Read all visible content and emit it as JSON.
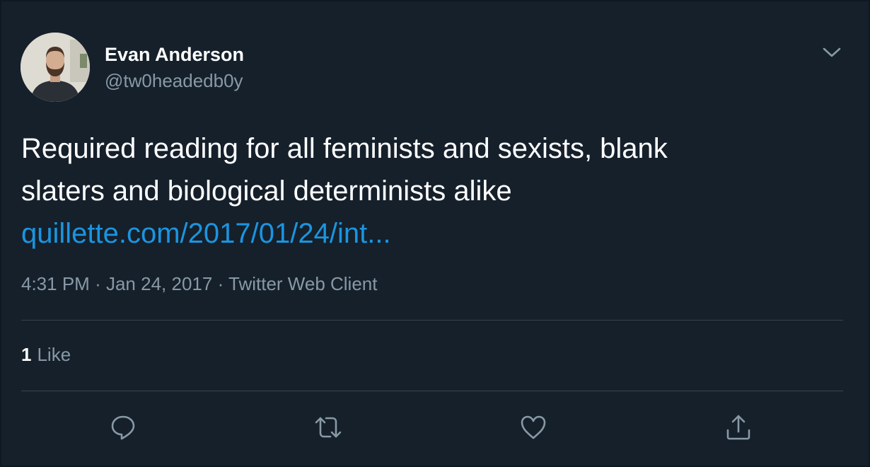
{
  "tweet": {
    "author": {
      "name": "Evan Anderson",
      "handle": "@tw0headedb0y"
    },
    "text_line_1": "Required reading for all feminists and sexists, blank",
    "text_line_2": "slaters and biological determinists alike",
    "link_text": "quillette.com/2017/01/24/int...",
    "time": "4:31 PM",
    "separator": "·",
    "date": "Jan 24, 2017",
    "client": "Twitter Web Client",
    "like_count": "1",
    "like_label": "Like"
  },
  "icons": {
    "menu": "chevron-down-icon",
    "reply": "reply-icon",
    "retweet": "retweet-icon",
    "like": "heart-icon",
    "share": "share-icon"
  },
  "colors": {
    "background": "#15202b",
    "text": "#ffffff",
    "secondary_text": "#8899a6",
    "link": "#1b95e0",
    "divider": "#38444d"
  }
}
